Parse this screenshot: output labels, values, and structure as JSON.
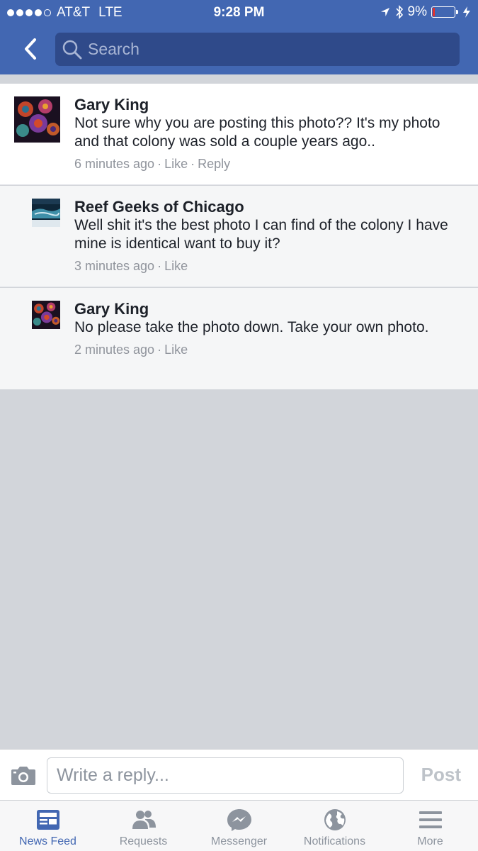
{
  "status_bar": {
    "carrier": "AT&T",
    "network": "LTE",
    "time": "9:28 PM",
    "battery": "9%",
    "battery_level": 0.09
  },
  "nav": {
    "back_icon": "chevron-left-icon",
    "search_placeholder": "Search"
  },
  "comments": [
    {
      "author": "Gary King",
      "text": "Not sure why you are posting this photo?? It's my photo and that colony was sold a couple years ago..",
      "time": "6 minutes ago",
      "actions": [
        "Like",
        "Reply"
      ]
    },
    {
      "author": "Reef Geeks of Chicago",
      "text": "Well shit it's the best photo I can find of the colony I have mine is identical want to buy it?",
      "time": "3 minutes ago",
      "actions": [
        "Like"
      ]
    },
    {
      "author": "Gary King",
      "text": "No please take the photo down. Take your own photo.",
      "time": "2 minutes ago",
      "actions": [
        "Like"
      ]
    }
  ],
  "reply_bar": {
    "placeholder": "Write a reply...",
    "post_label": "Post"
  },
  "tabs": [
    {
      "label": "News Feed",
      "icon": "news-feed-icon",
      "active": true
    },
    {
      "label": "Requests",
      "icon": "requests-icon",
      "active": false
    },
    {
      "label": "Messenger",
      "icon": "messenger-icon",
      "active": false
    },
    {
      "label": "Notifications",
      "icon": "globe-icon",
      "active": false
    },
    {
      "label": "More",
      "icon": "menu-icon",
      "active": false
    }
  ],
  "colors": {
    "brand": "#4267b2",
    "inactive": "#8d949e"
  }
}
